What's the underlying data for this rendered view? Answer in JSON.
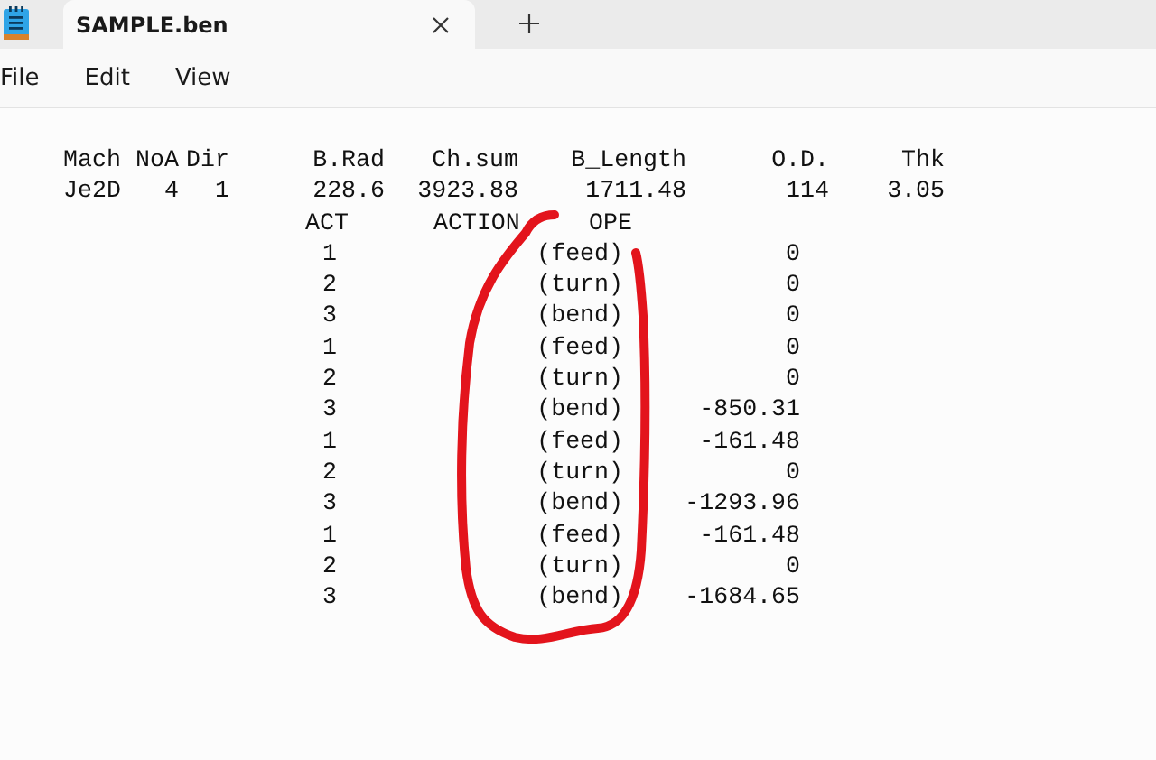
{
  "tabs": [
    {
      "title": "SAMPLE.ben",
      "selected": true
    }
  ],
  "menu": [
    "File",
    "Edit",
    "View"
  ],
  "document": {
    "header": {
      "columns": [
        "Mach",
        "NoA",
        "Dir",
        "B.Rad",
        "Ch.sum",
        "B_Length",
        "O.D.",
        "Thk"
      ],
      "values": [
        "Je2D",
        "4",
        "1",
        "228.6",
        "3923.88",
        "1711.48",
        "114",
        "3.05"
      ]
    },
    "step_columns": [
      "ACT",
      "ACTION",
      "OPE"
    ],
    "steps": [
      {
        "act": "1",
        "action": "(feed)",
        "ope": "0"
      },
      {
        "act": "2",
        "action": "(turn)",
        "ope": "0"
      },
      {
        "act": "3",
        "action": "(bend)",
        "ope": "0"
      },
      {
        "act": "1",
        "action": "(feed)",
        "ope": "0"
      },
      {
        "act": "2",
        "action": "(turn)",
        "ope": "0"
      },
      {
        "act": "3",
        "action": "(bend)",
        "ope": "-850.31"
      },
      {
        "act": "1",
        "action": "(feed)",
        "ope": "-161.48"
      },
      {
        "act": "2",
        "action": "(turn)",
        "ope": "0"
      },
      {
        "act": "3",
        "action": "(bend)",
        "ope": "-1293.96"
      },
      {
        "act": "1",
        "action": "(feed)",
        "ope": "-161.48"
      },
      {
        "act": "2",
        "action": "(turn)",
        "ope": "0"
      },
      {
        "act": "3",
        "action": "(bend)",
        "ope": "-1684.65"
      }
    ]
  }
}
